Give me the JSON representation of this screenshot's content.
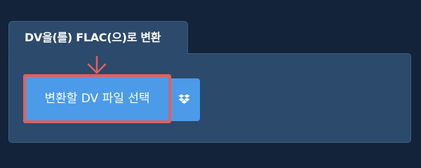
{
  "tab": {
    "title": "DV을(를) FLAC(으)로 변환"
  },
  "converter": {
    "select_button_label": "변환할 DV 파일 선택",
    "dropbox_icon": "dropbox-icon",
    "arrow_icon": "arrow-down-icon"
  },
  "colors": {
    "page_bg": "#13233a",
    "panel_bg": "#2c4a6b",
    "button_bg": "#4b9be8",
    "highlight": "#e0605f"
  }
}
